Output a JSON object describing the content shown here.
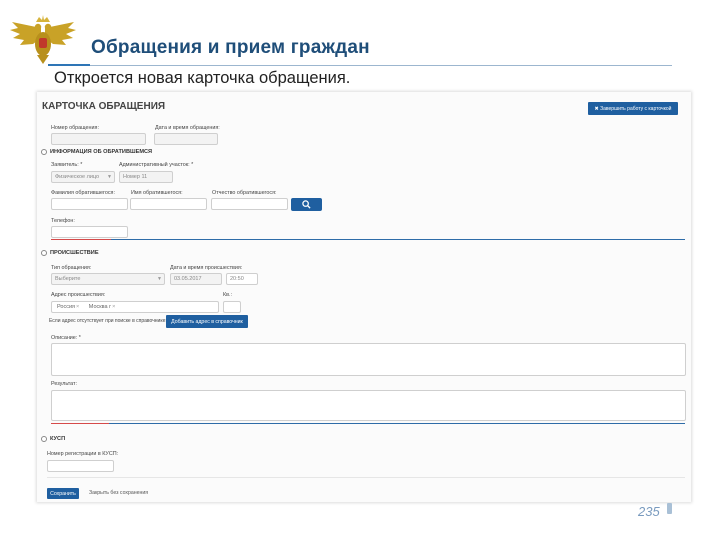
{
  "slide": {
    "title": "Обращения и прием граждан",
    "subtitle": "Откроется новая карточка обращения.",
    "page_number": "235"
  },
  "card": {
    "title": "КАРТОЧКА ОБРАЩЕНИЯ",
    "finish_button": "✖  Завершить работу с карточкой",
    "appeal_number_label": "Номер обращения:",
    "appeal_datetime_label": "Дата и время обращения:",
    "applicant_section": {
      "title": "ИНФОРМАЦИЯ ОБ ОБРАТИВШЕМСЯ",
      "applicant_label": "Заявитель: *",
      "applicant_value": "Физическое лицо",
      "district_label": "Административный участок: *",
      "district_value": "Номер 11",
      "surname_label": "Фамилия обратившегося:",
      "name_label": "Имя обратившегося:",
      "patronymic_label": "Отчество обратившегося:",
      "phone_label": "Телефон:"
    },
    "incident_section": {
      "title": "ПРОИСШЕСТВИЕ",
      "type_label": "Тип обращения:",
      "type_value": "Выберите",
      "incident_datetime_label": "Дата и время происшествия:",
      "date_value": "03.05.2017",
      "time_value": "20:50",
      "address_label": "Адрес происшествия:",
      "address_tags": [
        "Россия",
        "Москва г"
      ],
      "apartment_label": "Кв.:",
      "address_hint": "Если адрес отсутствует при поиске в справочнике:",
      "add_address_button": "Добавить адрес в справочник",
      "description_label": "Описание: *",
      "result_label": "Результат:"
    },
    "kusp_section": {
      "title": "КУСП",
      "registration_label": "Номер регистрации в КУСП:"
    },
    "save_button": "Сохранить",
    "close_without_saving": "Закрыть без сохранения"
  },
  "icons": {
    "emblem": "double-headed-eagle-emblem",
    "search": "search-icon"
  },
  "colors": {
    "title": "#1f4e79",
    "button": "#1f5fa0",
    "accent_line": "#2e6ca8",
    "required_line": "#d64a4a"
  }
}
